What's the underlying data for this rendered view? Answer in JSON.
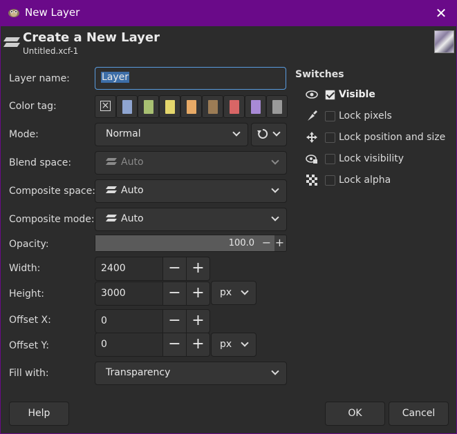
{
  "window": {
    "title": "New Layer",
    "app_icon": "gimp-icon",
    "close_icon": "close-icon"
  },
  "header": {
    "title": "Create a New Layer",
    "subtitle": "Untitled.xcf-1"
  },
  "labels": {
    "layer_name": "Layer name:",
    "color_tag": "Color tag:",
    "mode": "Mode:",
    "blend_space": "Blend space:",
    "composite_space": "Composite space:",
    "composite_mode": "Composite mode:",
    "opacity": "Opacity:",
    "width": "Width:",
    "height": "Height:",
    "offset_x": "Offset X:",
    "offset_y": "Offset Y:",
    "fill_with": "Fill with:"
  },
  "layer_name_value": "Layer",
  "color_tags": [
    "#8fa5d1",
    "#a8c072",
    "#e4d66c",
    "#e8aa66",
    "#9c7c55",
    "#d86666",
    "#a88ad6",
    "#9a9a9a"
  ],
  "mode": "Normal",
  "blend_space": "Auto",
  "composite_space": "Auto",
  "composite_mode": "Auto",
  "opacity": {
    "value": "100.0",
    "fraction": 0.94
  },
  "width": "2400",
  "height": "3000",
  "size_unit": "px",
  "offset_x": "0",
  "offset_y": "0",
  "offset_unit": "px",
  "fill_with": "Transparency",
  "switches": {
    "title": "Switches",
    "visible": "Visible",
    "lock_pixels": "Lock pixels",
    "lock_position": "Lock position and size",
    "lock_visibility": "Lock visibility",
    "lock_alpha": "Lock alpha"
  },
  "buttons": {
    "help": "Help",
    "ok": "OK",
    "cancel": "Cancel",
    "minus": "−",
    "plus": "+"
  }
}
